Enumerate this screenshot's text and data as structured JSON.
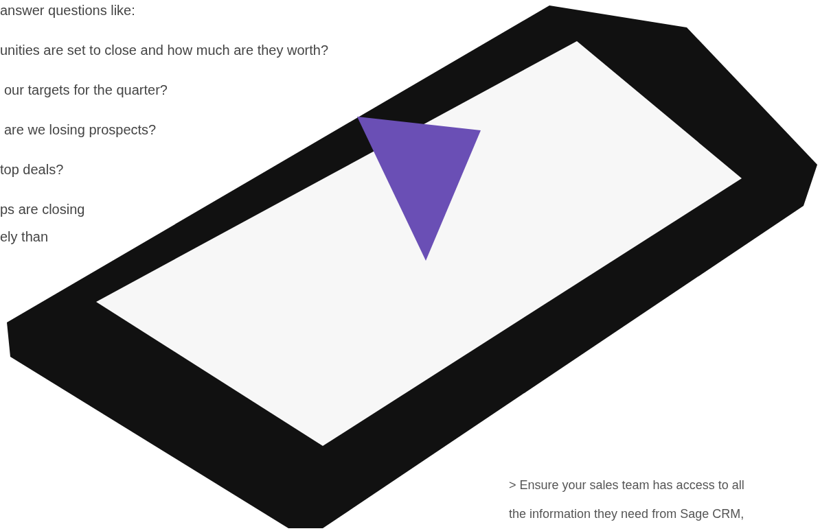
{
  "questions": [
    "answer questions like:",
    "unities are set to close and how much are they worth?",
    "our targets for the quarter?",
    "are we losing prospects?",
    "top deals?",
    "ps are closing",
    "ely than"
  ],
  "note_lines": [
    "> Ensure your sales team has access to all",
    "the information they need from Sage CRM,"
  ]
}
